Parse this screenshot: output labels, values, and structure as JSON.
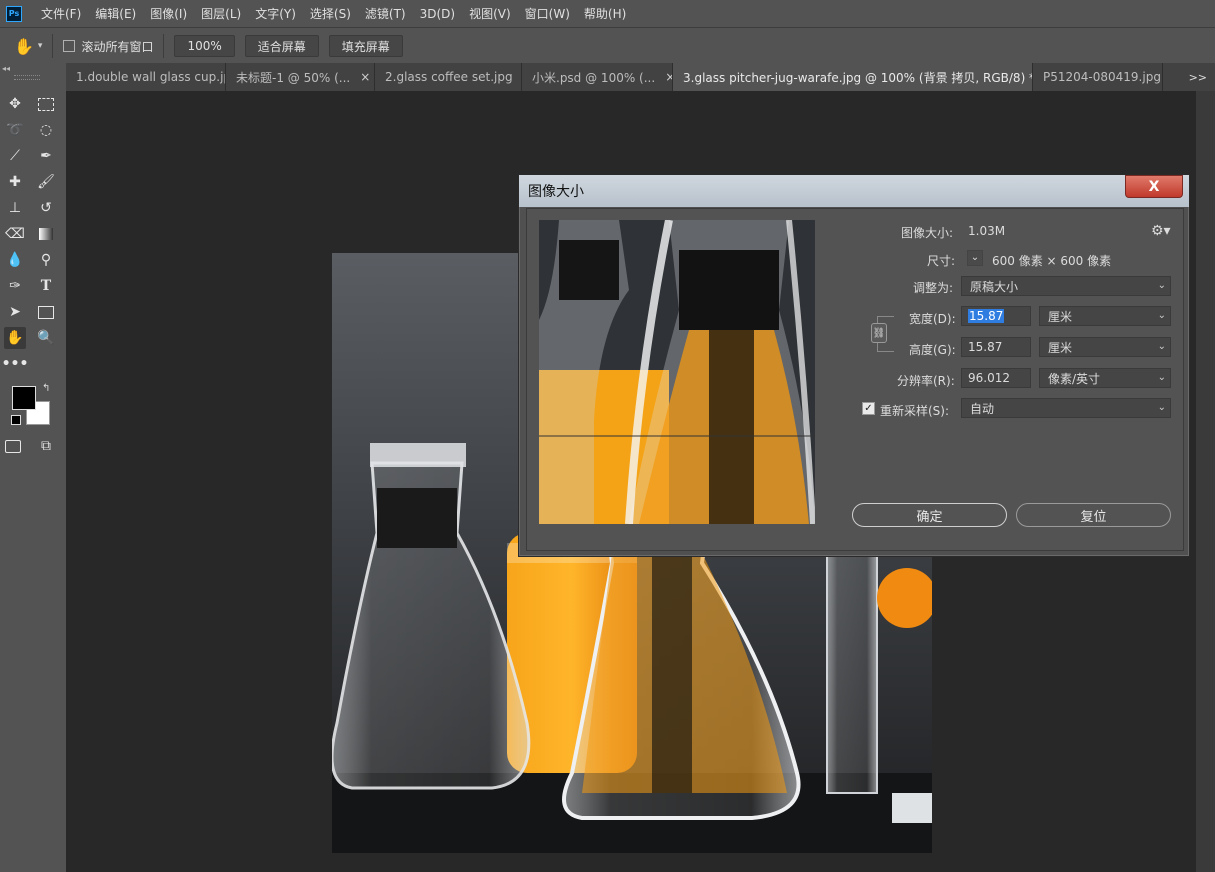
{
  "menubar": {
    "logo": "Ps",
    "items": [
      "文件(F)",
      "编辑(E)",
      "图像(I)",
      "图层(L)",
      "文字(Y)",
      "选择(S)",
      "滤镜(T)",
      "3D(D)",
      "视图(V)",
      "窗口(W)",
      "帮助(H)"
    ]
  },
  "options": {
    "scroll_all_label": "滚动所有窗口",
    "zoom_label": "100%",
    "fit_screen_label": "适合屏幕",
    "fill_screen_label": "填充屏幕"
  },
  "tabs": [
    {
      "label": "1.double wall glass cup.jpg",
      "active": false
    },
    {
      "label": "未标题-1 @ 50% (...",
      "active": false
    },
    {
      "label": "2.glass coffee set.jpg",
      "active": false
    },
    {
      "label": "小米.psd @ 100% (...",
      "active": false
    },
    {
      "label": "3.glass pitcher-jug-warafe.jpg @ 100% (背景 拷贝, RGB/8) *",
      "active": true
    },
    {
      "label": "P51204-080419.jpg",
      "active": false
    }
  ],
  "tab_close_glyph": "×",
  "tab_overflow": ">>",
  "dialog": {
    "title": "图像大小",
    "close": "X",
    "image_size_label": "图像大小:",
    "image_size_value": "1.03M",
    "dimensions_label": "尺寸:",
    "dimensions_value": "600 像素 × 600 像素",
    "fit_to_label": "调整为:",
    "fit_to_value": "原稿大小",
    "width_label": "宽度(D):",
    "width_value": "15.87",
    "width_unit": "厘米",
    "height_label": "高度(G):",
    "height_value": "15.87",
    "height_unit": "厘米",
    "resolution_label": "分辨率(R):",
    "resolution_value": "96.012",
    "resolution_unit": "像素/英寸",
    "resample_label": "重新采样(S):",
    "resample_value": "自动",
    "resample_checked": true,
    "ok_label": "确定",
    "reset_label": "复位"
  },
  "colors": {
    "accent_arrow": "#e53935",
    "selection_highlight": "#2f7de1"
  }
}
